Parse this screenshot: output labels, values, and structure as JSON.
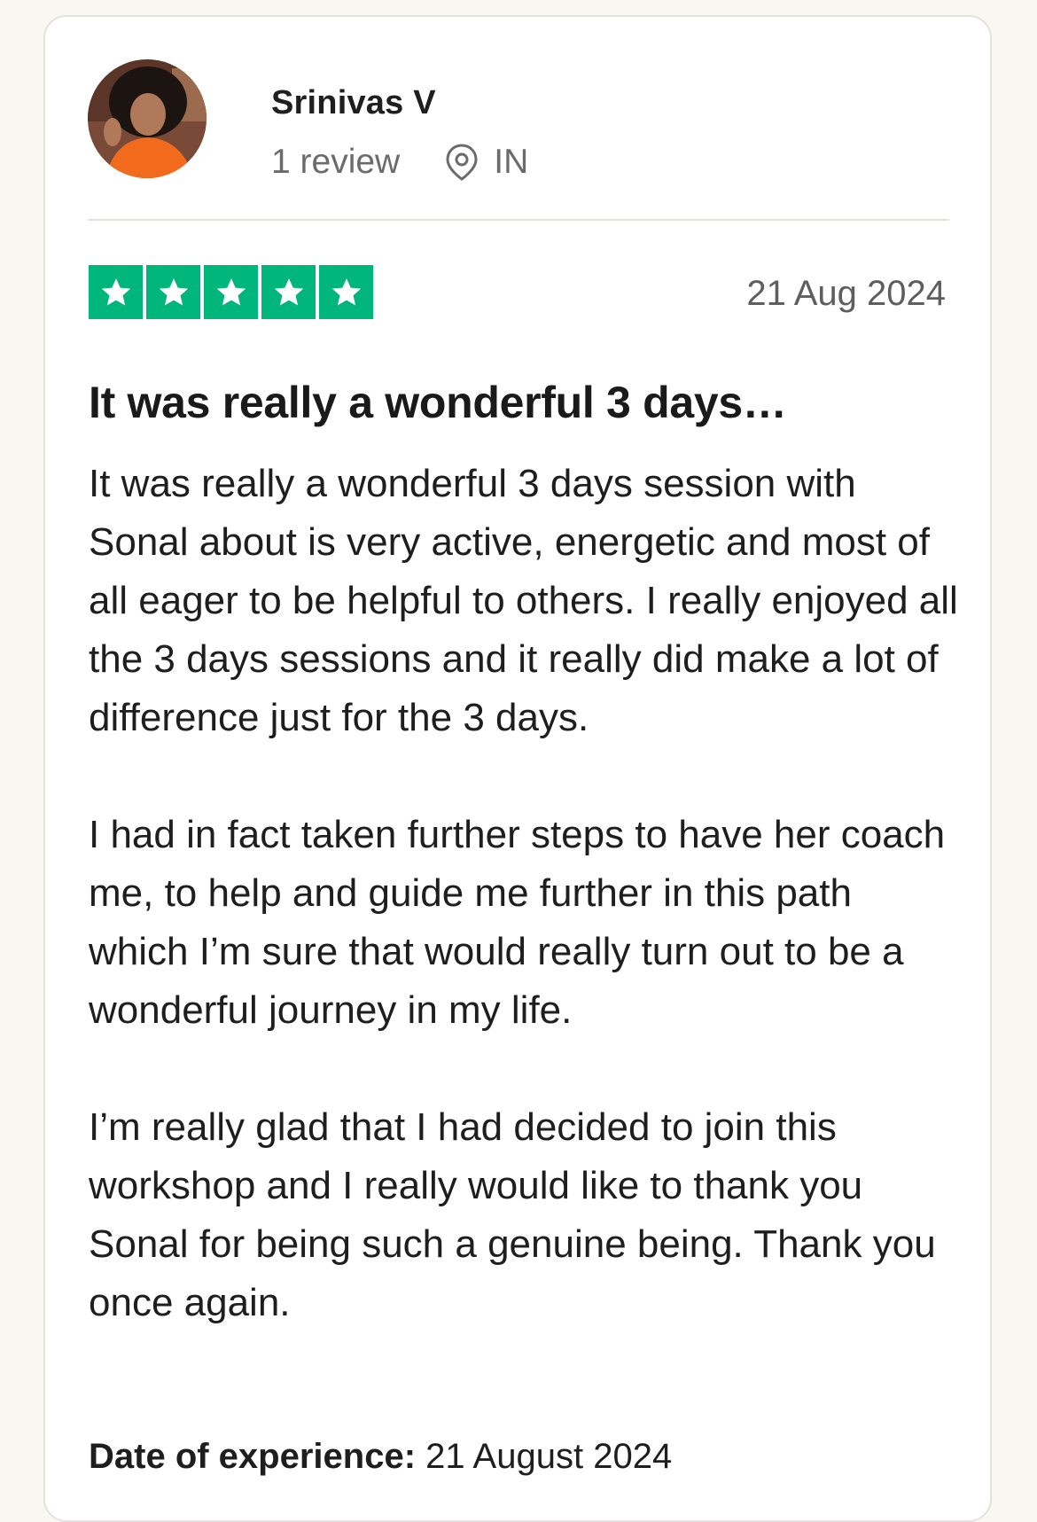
{
  "review": {
    "reviewer": {
      "name": "Srinivas V",
      "review_count": "1 review",
      "country": "IN"
    },
    "rating": 5,
    "rating_color": "#00b67a",
    "date": "21 Aug 2024",
    "title": "It was really a wonderful 3 days…",
    "paragraphs": [
      "It was really a wonderful 3 days session with Sonal about is very active, energetic and most of all eager to be helpful to others. I really enjoyed all the 3 days sessions and it really did make a lot of difference just for the 3 days.",
      "I had in fact taken further steps to have her coach me, to help and guide me further in this path which I’m sure that would really turn out to be a wonderful journey in my life.",
      "I’m really glad that I had decided to join this workshop and I really would like to thank you Sonal for being such a genuine being. Thank you once again."
    ],
    "experience_label": "Date of experience:",
    "experience_date": "21 August 2024"
  }
}
